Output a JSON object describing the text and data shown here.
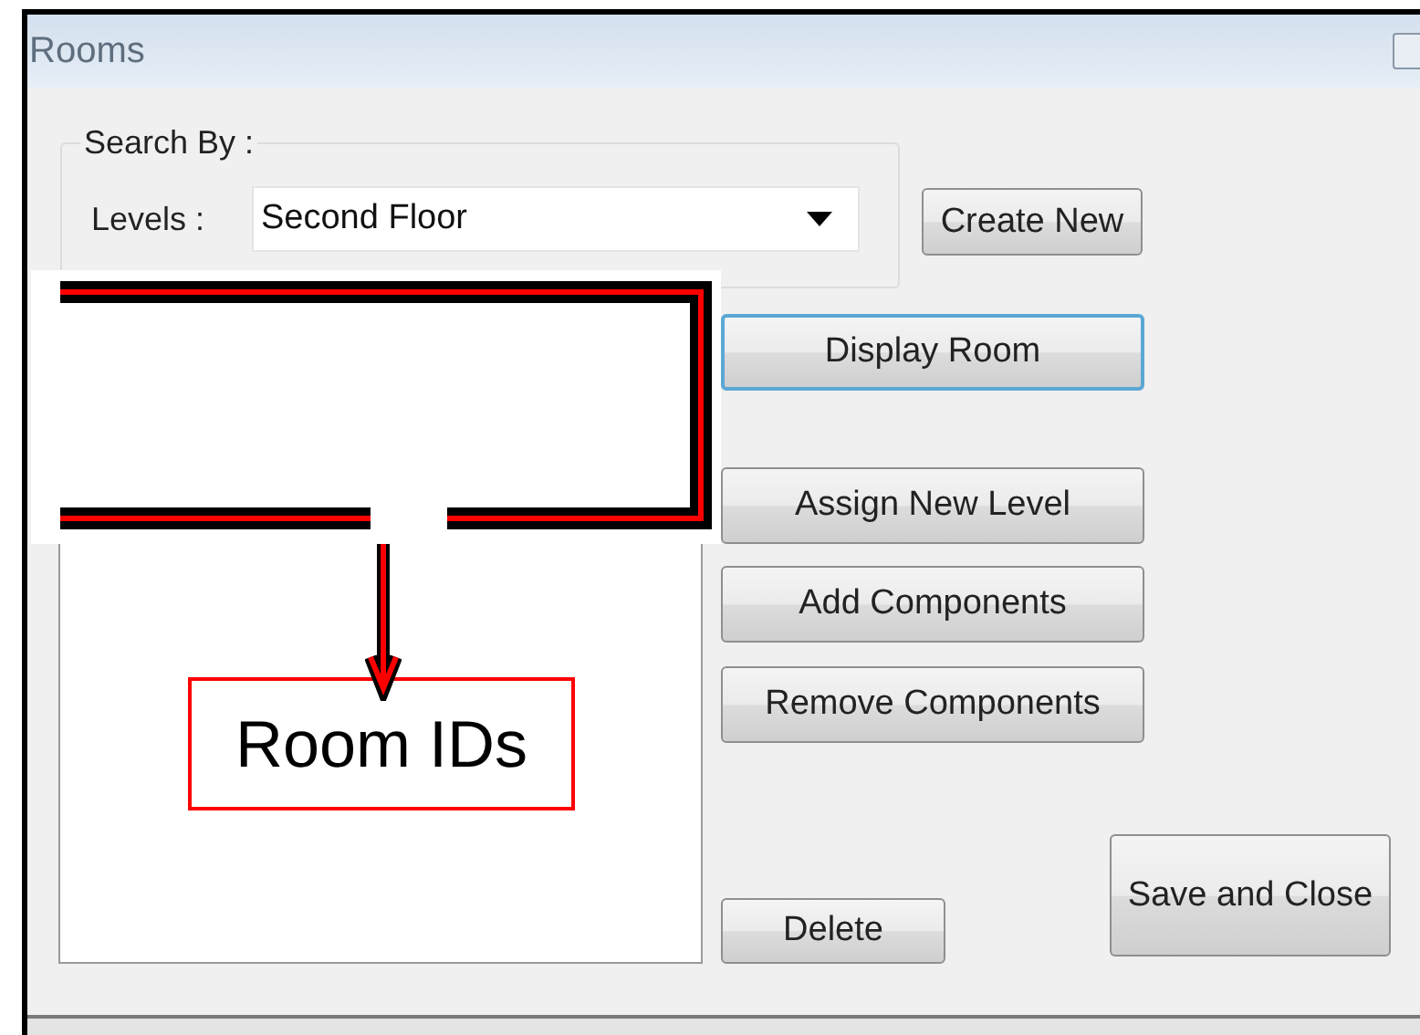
{
  "window": {
    "title": "Rooms"
  },
  "search_group": {
    "title": "Search By :",
    "levels_label": "Levels :",
    "levels_value": "Second Floor"
  },
  "create_button": "Create New",
  "action_buttons": [
    {
      "label": "Display Room",
      "focused": true
    },
    {
      "label": "Assign New Level",
      "focused": false
    },
    {
      "label": "Add Components",
      "focused": false
    },
    {
      "label": "Remove Components",
      "focused": false
    }
  ],
  "delete_button": "Delete",
  "save_button": "Save and Close",
  "annotation": {
    "label": "Room IDs"
  }
}
